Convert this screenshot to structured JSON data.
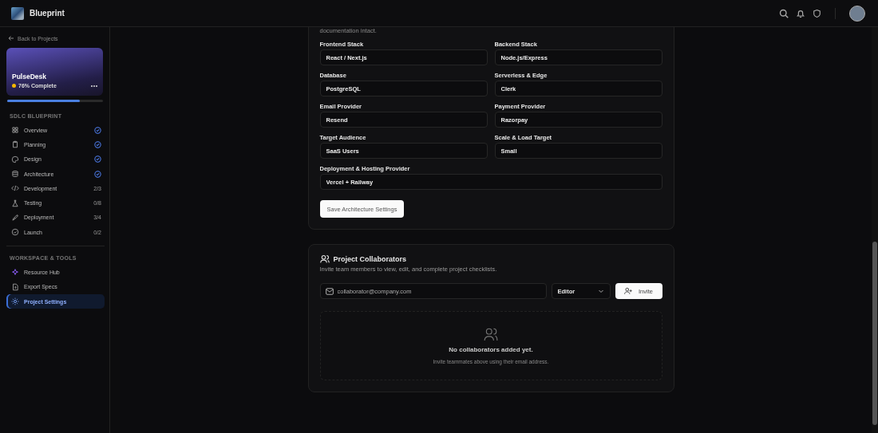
{
  "app": {
    "name": "Blueprint"
  },
  "sidebar": {
    "back_link": "Back to Projects",
    "project": {
      "name": "PulseDesk",
      "status": "76% Complete",
      "level": 0.76
    },
    "sections": [
      {
        "title": "SDLC BLUEPRINT",
        "items": [
          {
            "label": "Overview",
            "completed": true,
            "selected": false
          },
          {
            "label": "Planning",
            "completed": true,
            "selected": false
          },
          {
            "label": "Design",
            "completed": true,
            "selected": false
          },
          {
            "label": "Architecture",
            "completed": true,
            "selected": false
          },
          {
            "label": "Development",
            "completed": false,
            "count": "2/3",
            "selected": false
          },
          {
            "label": "Testing",
            "completed": false,
            "count": "0/8",
            "selected": false
          },
          {
            "label": "Deployment",
            "completed": false,
            "count": "3/4",
            "selected": false
          },
          {
            "label": "Launch",
            "completed": false,
            "count": "0/2",
            "selected": false
          }
        ]
      },
      {
        "title": "WORKSPACE & TOOLS",
        "items": [
          {
            "label": "Resource Hub",
            "completed": false,
            "selected": false
          },
          {
            "label": "Export Specs",
            "completed": false,
            "selected": false
          },
          {
            "label": "Project Settings",
            "completed": false,
            "selected": true
          }
        ]
      }
    ]
  },
  "architecture": {
    "description_tail": "documentation intact.",
    "fields": [
      {
        "label": "Frontend Stack",
        "value": "React / Next.js"
      },
      {
        "label": "Backend Stack",
        "value": "Node.js/Express"
      },
      {
        "label": "Database",
        "value": "PostgreSQL"
      },
      {
        "label": "Serverless & Edge",
        "value": "Clerk"
      },
      {
        "label": "Email Provider",
        "value": "Resend"
      },
      {
        "label": "Payment Provider",
        "value": "Razorpay"
      },
      {
        "label": "Target Audience",
        "value": "SaaS Users"
      },
      {
        "label": "Scale & Load Target",
        "value": "Small"
      },
      {
        "label": "Deployment & Hosting Provider",
        "value": "Vercel + Railway"
      }
    ],
    "save_button": "Save Architecture Settings"
  },
  "collaborators": {
    "title": "Project Collaborators",
    "description": "Invite team members to view, edit, and complete project checklists.",
    "email": {
      "placeholder": "collaborator@company.com"
    },
    "role": "Editor",
    "invite_button": "Invite",
    "empty_title": "No collaborators added yet.",
    "empty_hint": "Invite teammates above using their email address."
  }
}
